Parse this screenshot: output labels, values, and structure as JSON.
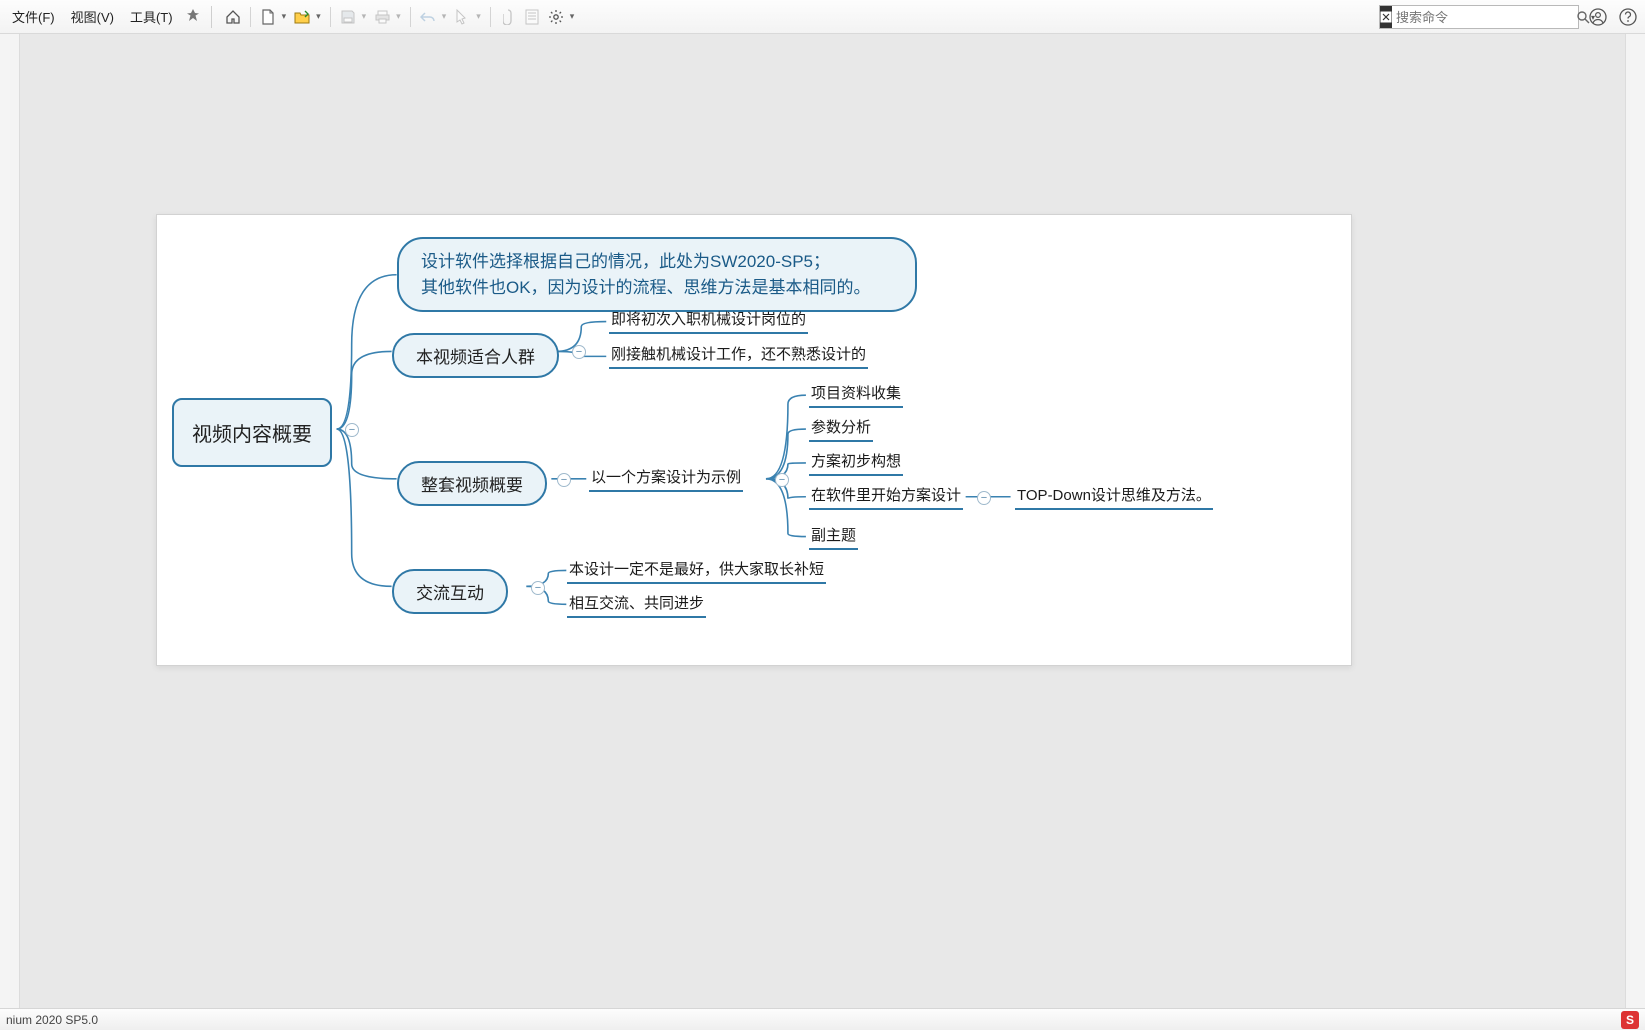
{
  "menu": {
    "file": "文件(F)",
    "view": "视图(V)",
    "tools": "工具(T)"
  },
  "search": {
    "placeholder": "搜索命令"
  },
  "status": {
    "left": "nium 2020 SP5.0",
    "ime": "S"
  },
  "mindmap": {
    "root": "视频内容概要",
    "note_line1": "设计软件选择根据自己的情况，此处为SW2020-SP5；",
    "note_line2": "其他软件也OK，因为设计的流程、思维方法是基本相同的。",
    "b1": "本视频适合人群",
    "b1_c1": "即将初次入职机械设计岗位的",
    "b1_c2": "刚接触机械设计工作，还不熟悉设计的",
    "b2": "整套视频概要",
    "b2_c0": "以一个方案设计为示例",
    "b2_c1": "项目资料收集",
    "b2_c2": "参数分析",
    "b2_c3": "方案初步构想",
    "b2_c4": "在软件里开始方案设计",
    "b2_c4_d1": "TOP-Down设计思维及方法。",
    "b2_c5": "副主题",
    "b3": "交流互动",
    "b3_c1": "本设计一定不是最好，供大家取长补短",
    "b3_c2": "相互交流、共同进步"
  }
}
